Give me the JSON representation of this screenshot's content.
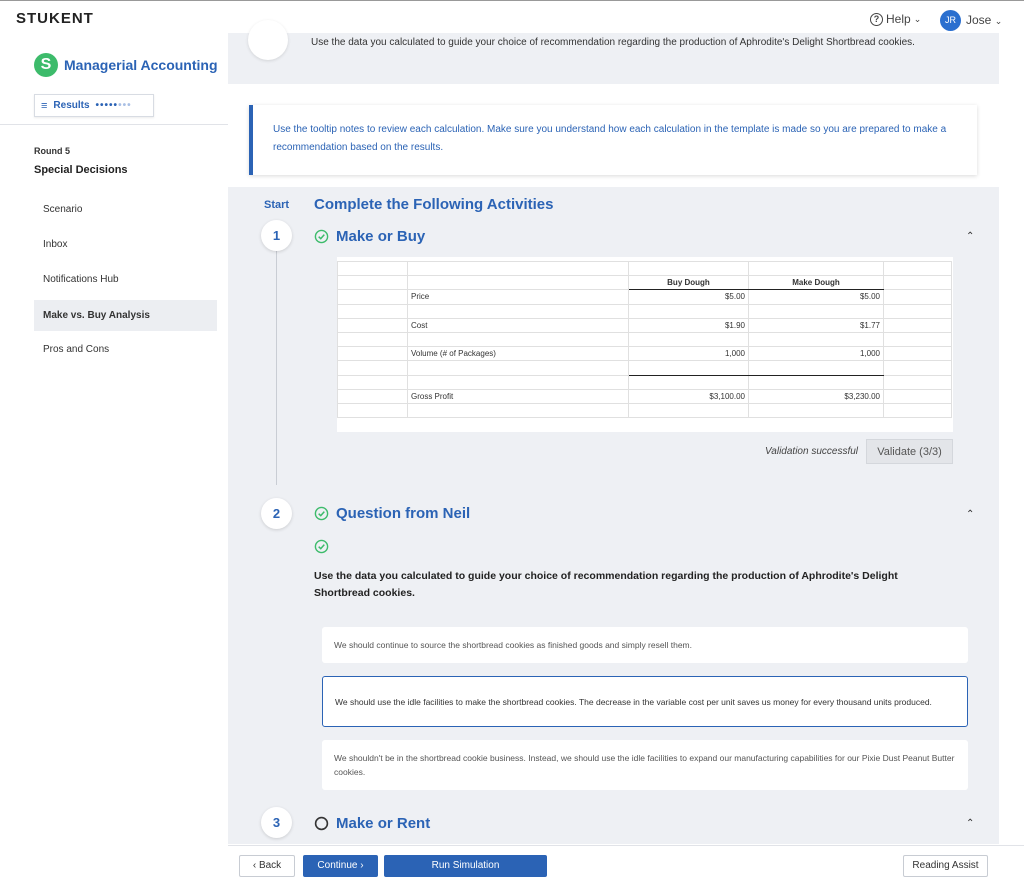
{
  "header": {
    "logo": "STUKENT",
    "help_label": "Help",
    "help_chevron": "⌄",
    "user_initials": "JR",
    "user_name": "Jose",
    "user_chevron": "⌄"
  },
  "sidebar": {
    "course_badge": "S",
    "course_title": "Managerial Accounting",
    "results_label": "Results",
    "results_icon": "≡",
    "round_label": "Round 5",
    "round_title": "Special Decisions",
    "items": [
      {
        "label": "Scenario",
        "active": false
      },
      {
        "label": "Inbox",
        "active": false
      },
      {
        "label": "Notifications Hub",
        "active": false
      },
      {
        "label": "Make vs. Buy Analysis",
        "active": true
      },
      {
        "label": "Pros and Cons",
        "active": false
      }
    ]
  },
  "main": {
    "top_question": "Use the data you calculated to guide your choice of recommendation regarding the production of Aphrodite's Delight Shortbread cookies.",
    "note": "Use the tooltip notes to review each calculation. Make sure you understand how each calculation in the template is made so you are prepared to make a recommendation based on the results.",
    "start_label": "Start",
    "section_heading": "Complete the Following Activities",
    "steps": [
      {
        "number": "1",
        "title": "Make or Buy",
        "status": "complete"
      },
      {
        "number": "2",
        "title": "Question from Neil",
        "status": "complete"
      },
      {
        "number": "3",
        "title": "Make or Rent",
        "status": "incomplete"
      }
    ],
    "chevron_up": "⌃",
    "sheet": {
      "headers": [
        "Buy Dough",
        "Make Dough"
      ],
      "rows": [
        {
          "label": "Price",
          "buy": "$5.00",
          "make": "$5.00"
        },
        {
          "label": "Cost",
          "buy": "$1.90",
          "make": "$1.77"
        },
        {
          "label": "Volume (# of Packages)",
          "buy": "1,000",
          "make": "1,000"
        },
        {
          "label": "Gross Profit",
          "buy": "$3,100.00",
          "make": "$3,230.00"
        }
      ]
    },
    "validation_text": "Validation successful",
    "validate_button": "Validate (3/3)",
    "question": "Use the data you calculated to guide your choice of recommendation regarding the production of Aphrodite's Delight Shortbread cookies.",
    "options": [
      {
        "text": "We should continue to source the shortbread cookies as finished goods and simply resell them.",
        "selected": false
      },
      {
        "text": "We should use the idle facilities to make the shortbread cookies. The decrease in the variable cost per unit saves us money for every thousand units produced.",
        "selected": true
      },
      {
        "text": "We shouldn't be in the shortbread cookie business. Instead, we should use the idle facilities to expand our manufacturing capabilities for our Pixie Dust Peanut Butter cookies.",
        "selected": false
      }
    ]
  },
  "footer": {
    "back_label": "Back",
    "back_icon": "‹",
    "continue_label": "Continue",
    "continue_icon": "›",
    "run_label": "Run Simulation",
    "reading_label": "Reading Assist"
  },
  "colors": {
    "brand_blue": "#2b63b5",
    "success_green": "#3dbb6b",
    "panel_bg": "#eef0f4"
  }
}
